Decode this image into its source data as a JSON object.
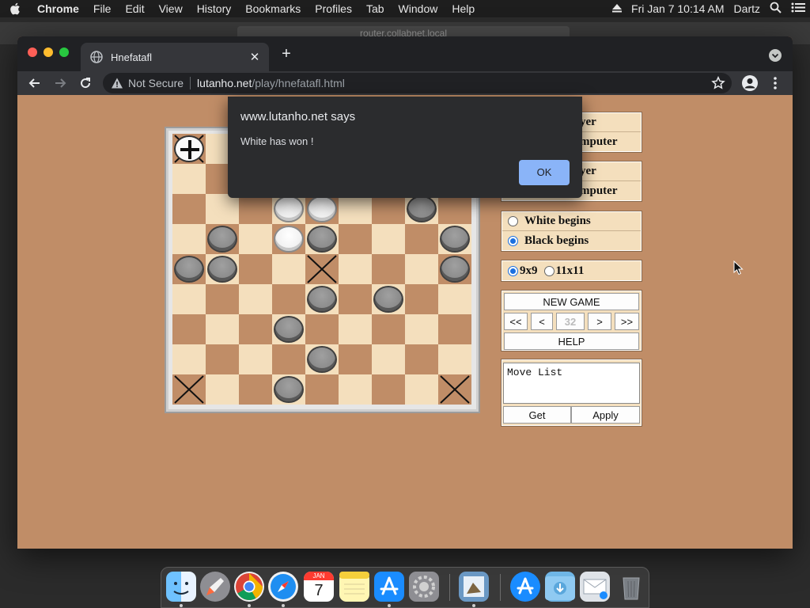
{
  "menubar": {
    "app": "Chrome",
    "items": [
      "File",
      "Edit",
      "View",
      "History",
      "Bookmarks",
      "Profiles",
      "Tab",
      "Window",
      "Help"
    ],
    "clock": "Fri Jan 7  10:14 AM",
    "user": "Dartz"
  },
  "background_window": {
    "address": "router.collabnet.local"
  },
  "browser": {
    "tab_title": "Hnefatafl",
    "omnibox": {
      "security": "Not Secure",
      "host": "lutanho.net",
      "path": "/play/hnefatafl.html"
    }
  },
  "alert": {
    "origin": "www.lutanho.net says",
    "message": "White has won !",
    "ok_label": "OK"
  },
  "board": {
    "size": 9,
    "light_color": "#f4dfbd",
    "dark_color": "#c08d67",
    "x_squares": [
      [
        0,
        0
      ],
      [
        0,
        8
      ],
      [
        4,
        4
      ],
      [
        8,
        0
      ],
      [
        8,
        8
      ]
    ],
    "pieces": [
      {
        "row": 0,
        "col": 0,
        "color": "king"
      },
      {
        "row": 2,
        "col": 3,
        "color": "white"
      },
      {
        "row": 2,
        "col": 4,
        "color": "white"
      },
      {
        "row": 2,
        "col": 7,
        "color": "black"
      },
      {
        "row": 3,
        "col": 1,
        "color": "black"
      },
      {
        "row": 3,
        "col": 3,
        "color": "white"
      },
      {
        "row": 3,
        "col": 4,
        "color": "black"
      },
      {
        "row": 3,
        "col": 8,
        "color": "black"
      },
      {
        "row": 4,
        "col": 0,
        "color": "black"
      },
      {
        "row": 4,
        "col": 1,
        "color": "black"
      },
      {
        "row": 4,
        "col": 8,
        "color": "black"
      },
      {
        "row": 5,
        "col": 4,
        "color": "black"
      },
      {
        "row": 5,
        "col": 6,
        "color": "black"
      },
      {
        "row": 6,
        "col": 3,
        "color": "black"
      },
      {
        "row": 7,
        "col": 4,
        "color": "black"
      },
      {
        "row": 8,
        "col": 3,
        "color": "black"
      }
    ]
  },
  "controls": {
    "player_group_1": [
      "yer",
      "mputer"
    ],
    "player_group_2": [
      "yer",
      "mputer"
    ],
    "begins": [
      {
        "label": "White begins",
        "selected": false
      },
      {
        "label": "Black begins",
        "selected": true
      }
    ],
    "size_options": [
      {
        "label": "9x9",
        "selected": true
      },
      {
        "label": "11x11",
        "selected": false
      }
    ],
    "new_game_label": "NEW GAME",
    "nav": {
      "first": "<<",
      "prev": "<",
      "move_number": "32",
      "next": ">",
      "last": ">>"
    },
    "help_label": "HELP",
    "move_list_text": "Move List",
    "get_label": "Get",
    "apply_label": "Apply"
  },
  "dock": {
    "apps": [
      "finder-icon",
      "launchpad-icon",
      "chrome-icon",
      "safari-icon",
      "calendar-icon",
      "notes-icon",
      "app-store-icon",
      "system-preferences-icon",
      "preview-icon",
      "app-store-2-icon",
      "downloads-folder-icon",
      "mail-icon",
      "trash-icon"
    ],
    "calendar": {
      "month": "JAN",
      "day": "7"
    }
  }
}
